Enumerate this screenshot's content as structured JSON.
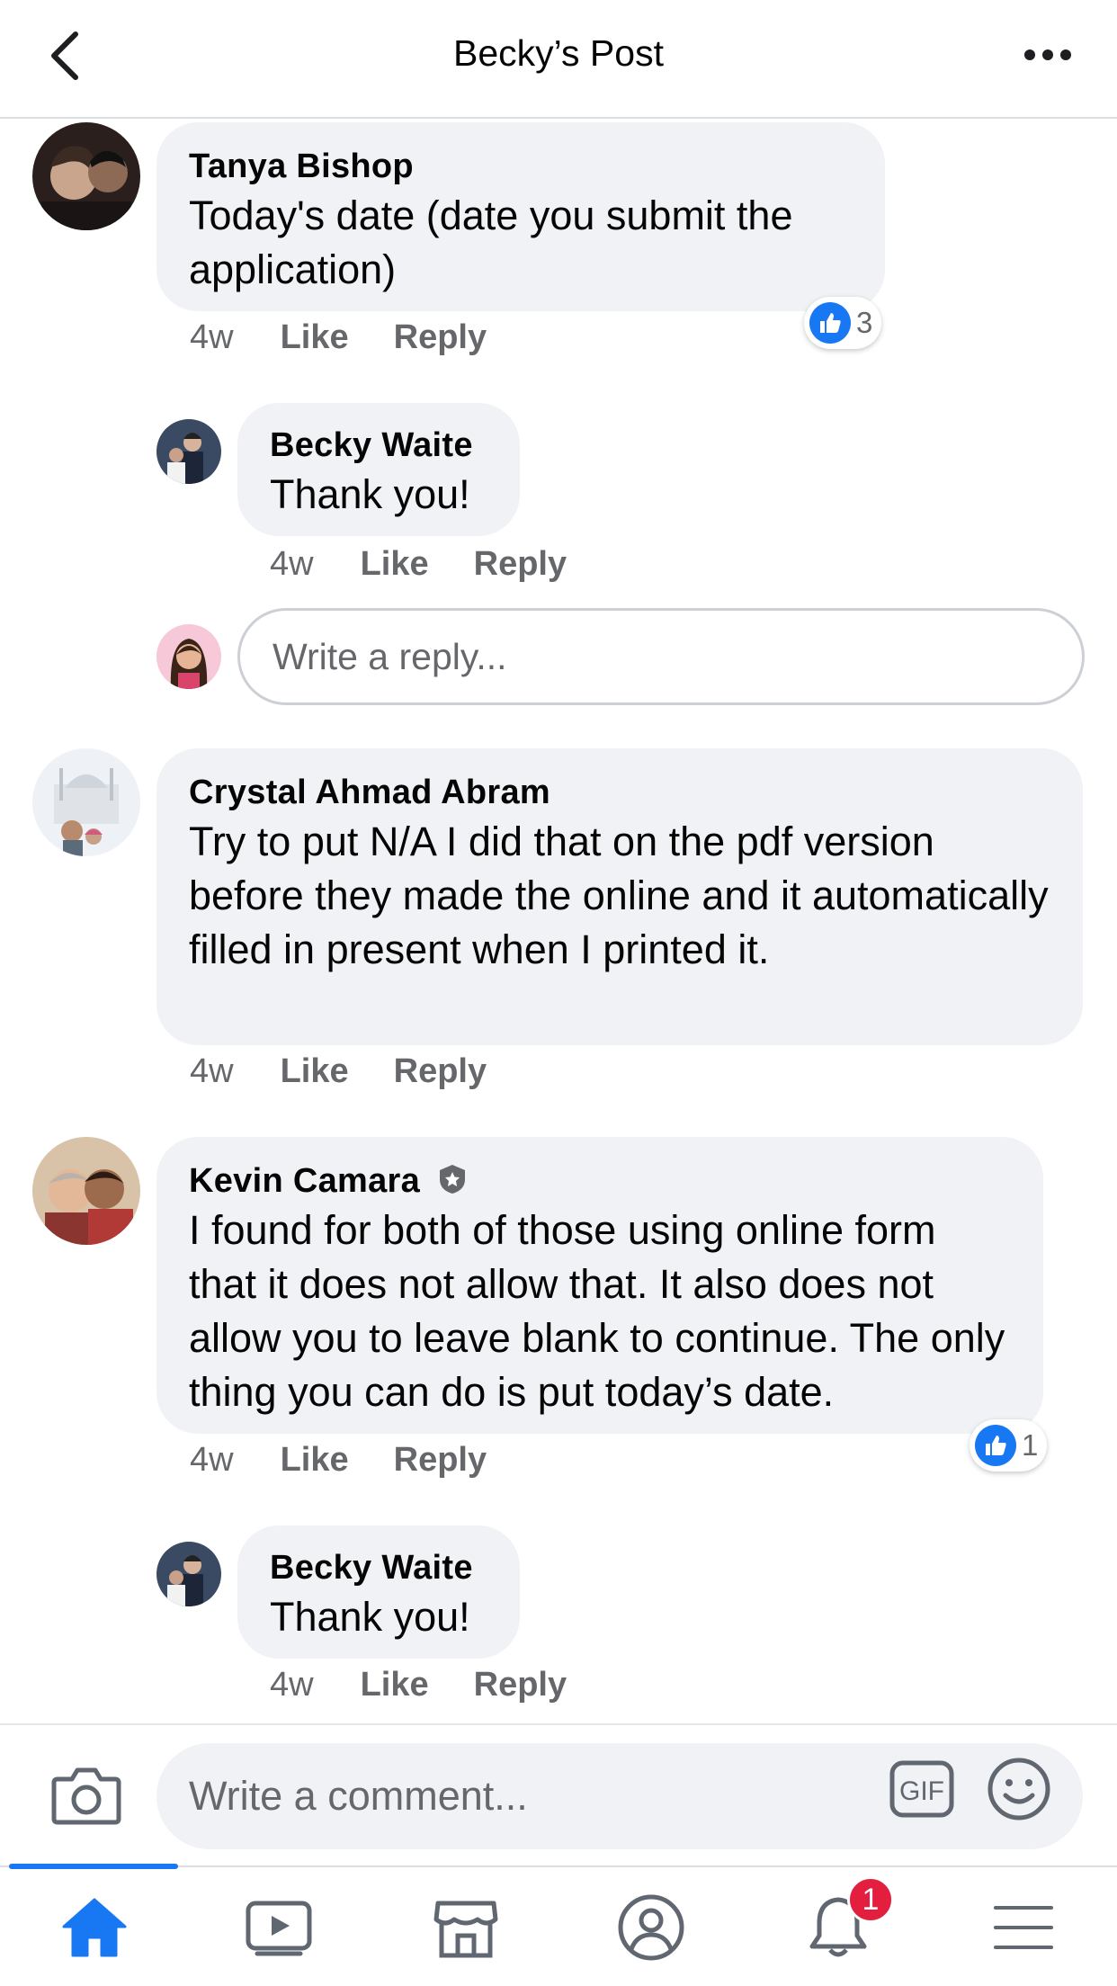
{
  "header": {
    "title": "Becky’s Post",
    "back_icon": "chevron-left-icon",
    "more_icon": "more-horizontal-icon"
  },
  "comments": [
    {
      "author": "Tanya Bishop",
      "text": "Today's date (date you submit the application)",
      "time": "4w",
      "like": "Like",
      "reply": "Reply",
      "reactions": "3"
    },
    {
      "author": "Becky Waite",
      "text": "Thank you!",
      "time": "4w",
      "like": "Like",
      "reply": "Reply"
    },
    {
      "author": "Crystal Ahmad Abram",
      "text": "Try to put N/A I did that on the pdf version before they made the online and it automatically filled in present when I printed it.",
      "time": "4w",
      "like": "Like",
      "reply": "Reply"
    },
    {
      "author": "Kevin Camara",
      "text": "I found for both of those using online form that it does not allow that. It also does not allow you to leave blank to continue. The only thing you can do is put today’s date.",
      "time": "4w",
      "like": "Like",
      "reply": "Reply",
      "reactions": "1"
    },
    {
      "author": "Becky Waite",
      "text": "Thank you!",
      "time": "4w",
      "like": "Like",
      "reply": "Reply"
    }
  ],
  "reply_box": {
    "placeholder": "Write a reply..."
  },
  "comment_bar": {
    "placeholder": "Write a comment...",
    "gif_label": "GIF"
  },
  "tabbar": {
    "items": [
      "home-icon",
      "video-icon",
      "marketplace-icon",
      "profile-icon",
      "notifications-icon",
      "menu-icon"
    ],
    "notification_count": "1"
  },
  "colors": {
    "accent": "#1877f2",
    "bubble": "#f0f2f5",
    "secondary_text": "#65676b",
    "badge": "#e41e3f"
  }
}
